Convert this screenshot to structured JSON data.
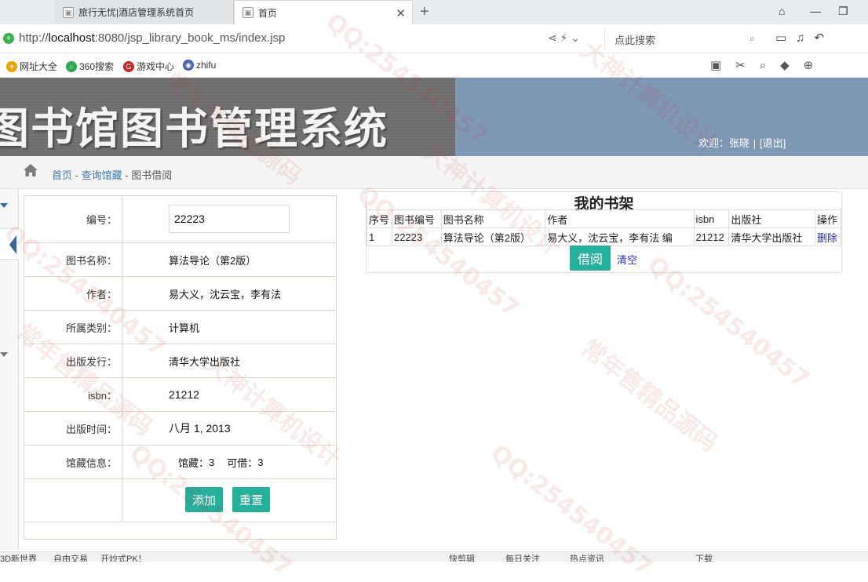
{
  "browser": {
    "tabs": [
      {
        "label": "旅行无忧|酒店管理系统首页",
        "active": false
      },
      {
        "label": "首页",
        "active": true
      }
    ],
    "url_prefix": "http://",
    "url_host": "localhost",
    "url_rest": ":8080/jsp_library_book_ms/index.jsp",
    "search_placeholder": "点此搜索",
    "bookmarks": [
      "网址大全",
      "360搜索",
      "游戏中心",
      "zhifu"
    ]
  },
  "banner": {
    "title": "图书馆图书管理系统",
    "welcome_prefix": "欢迎：",
    "user": "张晓",
    "logout": "[退出]"
  },
  "breadcrumb": {
    "home": "首页",
    "section": "查询馆藏",
    "current": "图书借阅",
    "sep": "-"
  },
  "book_form": {
    "id_label": "编号：",
    "id_value": "22223",
    "name_label": "图书名称：",
    "name_value": "算法导论（第2版）",
    "author_label": "作者：",
    "author_value": "易大义，沈云宝，李有法",
    "category_label": "所属类别：",
    "category_value": "计算机",
    "publisher_label": "出版发行：",
    "publisher_value": "清华大学出版社",
    "isbn_label": "isbn：",
    "isbn_value": "21212",
    "date_label": "出版时间：",
    "date_value": "八月 1, 2013",
    "holdings_label": "馆藏信息：",
    "holdings_total_label": "馆藏：",
    "holdings_total": "3",
    "holdings_available_label": "可借：",
    "holdings_available": "3",
    "add_button": "添加",
    "reset_button": "重置"
  },
  "shelf": {
    "title": "我的书架",
    "columns": [
      "序号",
      "图书编号",
      "图书名称",
      "作者",
      "isbn",
      "出版社",
      "操作"
    ],
    "rows": [
      {
        "no": "1",
        "book_id": "22223",
        "name": "算法导论（第2版）",
        "author": "易大义，沈云宝，李有法 编",
        "isbn": "21212",
        "publisher": "清华大学出版社",
        "action": "删除"
      }
    ],
    "borrow_button": "借阅",
    "clear_link": "清空"
  },
  "statusbar": {
    "items": [
      "3D新世界",
      "自由交易",
      "开炒式PK！",
      "快剪辑",
      "每日关注",
      "热点资讯",
      "下载"
    ]
  },
  "watermarks": [
    "QQ:254540457",
    "大神计算机设计",
    "常年售精品源码"
  ],
  "colors": {
    "banner_blue": "#7f98b6",
    "button_teal": "#25b09b",
    "link_blue": "#3a76b6"
  }
}
